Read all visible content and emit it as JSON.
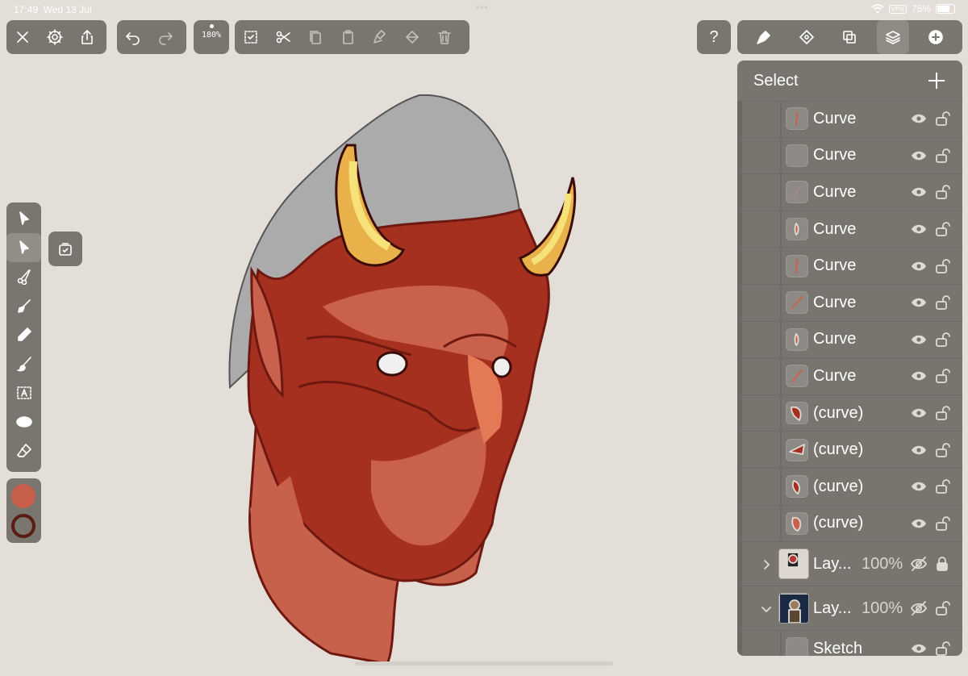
{
  "status": {
    "time": "17:49",
    "date": "Wed 13 Jul",
    "vpn": "VPN",
    "battery": "75%"
  },
  "toolbar": {
    "left_group": [
      "close-icon",
      "settings-icon",
      "share-icon"
    ],
    "history_group": [
      "undo-icon",
      "redo-icon"
    ],
    "zoom": "180%",
    "edit_group": [
      "select-all-icon",
      "cut-icon",
      "copy-icon",
      "paste-icon",
      "paste-style-icon",
      "fill-icon",
      "trash-icon"
    ],
    "help_label": "?",
    "right_group": [
      "brush-settings-icon",
      "snapping-icon",
      "boolean-icon",
      "layers-icon",
      "add-icon"
    ]
  },
  "tools": [
    "select-arrow-icon",
    "node-arrow-icon",
    "scissors-icon",
    "pen-icon",
    "pencil-icon",
    "brush-icon",
    "text-icon",
    "shape-icon",
    "eraser-icon"
  ],
  "colors": {
    "fill": "#c85f4c",
    "stroke": "#5b1a12"
  },
  "layers_panel": {
    "title": "Select",
    "rows": [
      {
        "name": "Curve",
        "thumb": "curve-thin"
      },
      {
        "name": "Curve",
        "thumb": "empty"
      },
      {
        "name": "Curve",
        "thumb": "curve-faint"
      },
      {
        "name": "Curve",
        "thumb": "curve-red"
      },
      {
        "name": "Curve",
        "thumb": "curve-thin"
      },
      {
        "name": "Curve",
        "thumb": "curve-line"
      },
      {
        "name": "Curve",
        "thumb": "curve-red"
      },
      {
        "name": "Curve",
        "thumb": "curve-line"
      },
      {
        "name": "(curve)",
        "thumb": "shape-a"
      },
      {
        "name": "(curve)",
        "thumb": "shape-b"
      },
      {
        "name": "(curve)",
        "thumb": "shape-c"
      },
      {
        "name": "(curve)",
        "thumb": "shape-d"
      }
    ],
    "layers": [
      {
        "name": "Lay...",
        "opacity": "100%",
        "expanded": false
      },
      {
        "name": "Lay...",
        "opacity": "100%",
        "expanded": true
      }
    ],
    "sketch": {
      "name": "Sketch"
    }
  }
}
